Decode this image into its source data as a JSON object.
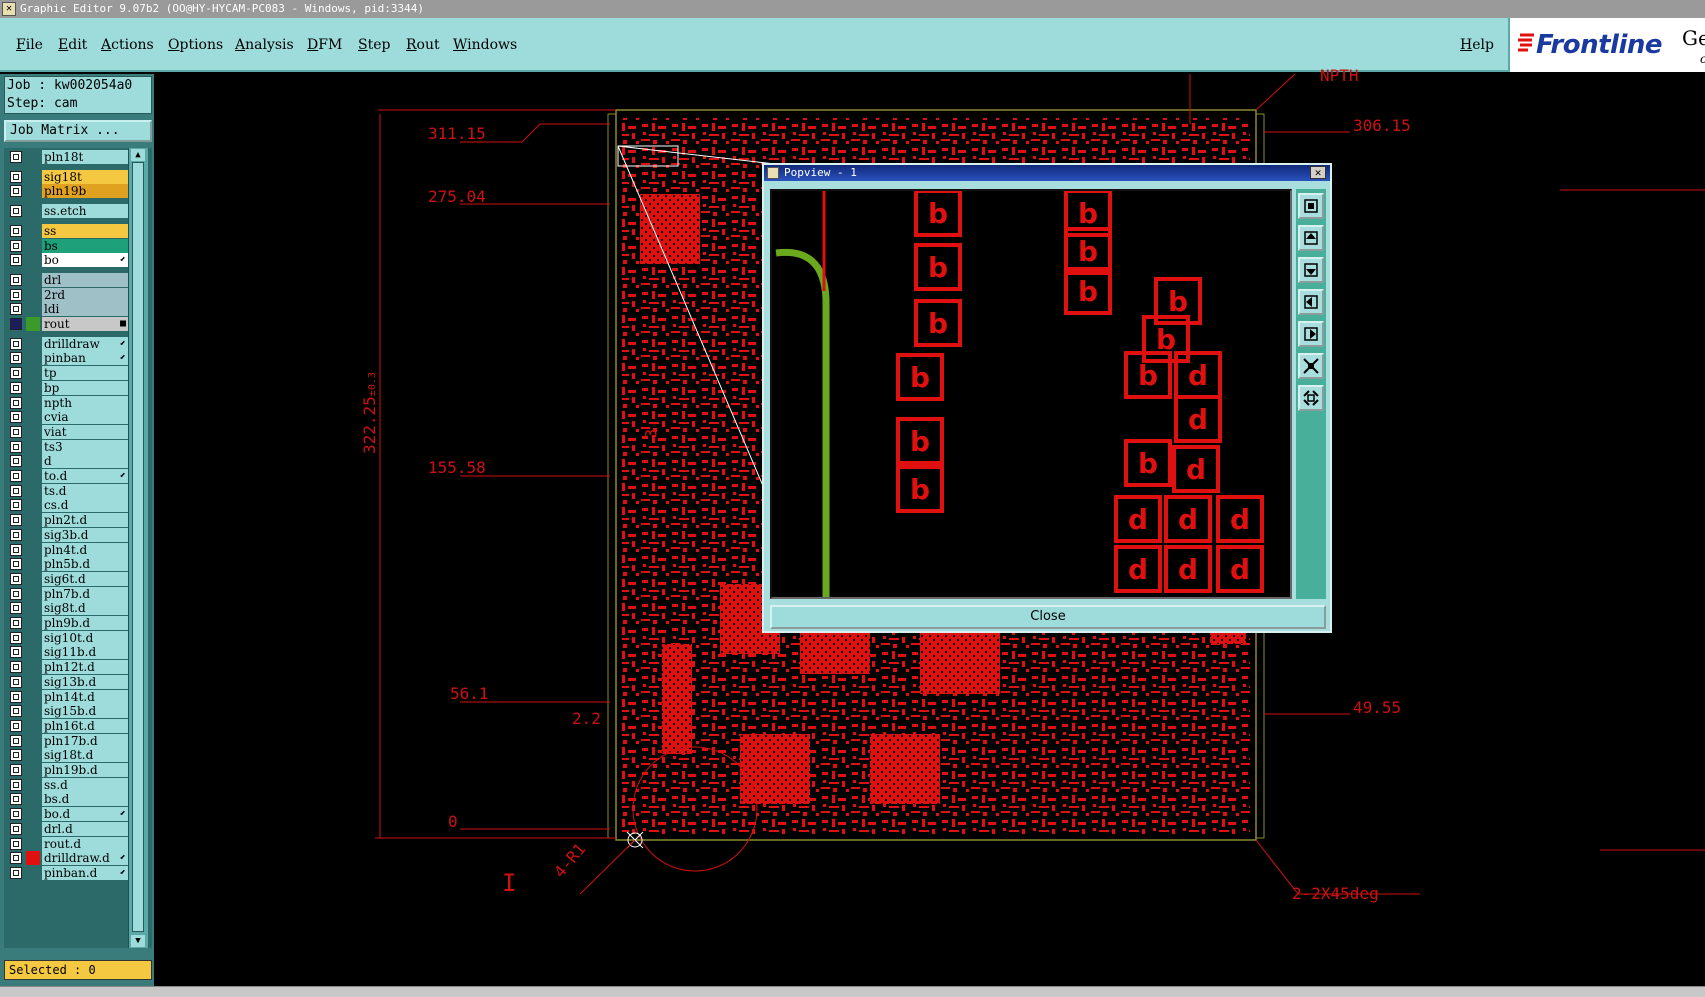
{
  "window": {
    "title": "Graphic Editor 9.07b2 (OO@HY-HYCAM-PC083 - Windows, pid:3344)"
  },
  "menu": {
    "items": [
      "File",
      "Edit",
      "Actions",
      "Options",
      "Analysis",
      "DFM",
      "Step",
      "Rout",
      "Windows"
    ],
    "help": "Help"
  },
  "logo": {
    "brand": "Frontline",
    "ge": "Ge",
    "c": "c",
    "accent": "#1a3aa0"
  },
  "job": {
    "job_line": "Job : kw002054a0",
    "step_line": "Step: cam",
    "matrix_button": "Job Matrix ..."
  },
  "layers": [
    {
      "name": "pln18t",
      "color": "",
      "flag": "",
      "gap_before": false
    },
    {
      "name": "sig18t",
      "color": "#f5c842",
      "flag": "",
      "gap_before": true
    },
    {
      "name": "pln19b",
      "color": "#e0a020",
      "flag": "",
      "gap_before": false
    },
    {
      "name": "ss.etch",
      "color": "",
      "flag": "",
      "gap_before": true
    },
    {
      "name": "ss",
      "color": "#f5c842",
      "flag": "",
      "gap_before": true
    },
    {
      "name": "bs",
      "color": "#1ea07a",
      "flag": "",
      "gap_before": false
    },
    {
      "name": "bo",
      "color": "#ffffff",
      "flag": "⬋",
      "gap_before": false
    },
    {
      "name": "drl",
      "color": "#a0c0c8",
      "flag": "",
      "gap_before": true
    },
    {
      "name": "2rd",
      "color": "#a0c0c8",
      "flag": "",
      "gap_before": false
    },
    {
      "name": "ldi",
      "color": "#a0c0c8",
      "flag": "",
      "gap_before": false
    },
    {
      "name": "rout",
      "color": "#c8c8c8",
      "flag": "■",
      "gap_before": false,
      "active": true,
      "swatch": "#3a9a2a"
    },
    {
      "name": "drilldraw",
      "color": "",
      "flag": "⬋",
      "gap_before": true
    },
    {
      "name": "pinban",
      "color": "",
      "flag": "⬋",
      "gap_before": false
    },
    {
      "name": "tp",
      "color": "",
      "flag": "",
      "gap_before": false
    },
    {
      "name": "bp",
      "color": "",
      "flag": "",
      "gap_before": false
    },
    {
      "name": "npth",
      "color": "",
      "flag": "",
      "gap_before": false
    },
    {
      "name": "cvia",
      "color": "",
      "flag": "",
      "gap_before": false
    },
    {
      "name": "viat",
      "color": "",
      "flag": "",
      "gap_before": false
    },
    {
      "name": "ts3",
      "color": "",
      "flag": "",
      "gap_before": false
    },
    {
      "name": "d",
      "color": "",
      "flag": "",
      "gap_before": false
    },
    {
      "name": "to.d",
      "color": "",
      "flag": "⬋",
      "gap_before": false
    },
    {
      "name": "ts.d",
      "color": "",
      "flag": "",
      "gap_before": false
    },
    {
      "name": "cs.d",
      "color": "",
      "flag": "",
      "gap_before": false
    },
    {
      "name": "pln2t.d",
      "color": "",
      "flag": "",
      "gap_before": false
    },
    {
      "name": "sig3b.d",
      "color": "",
      "flag": "",
      "gap_before": false
    },
    {
      "name": "pln4t.d",
      "color": "",
      "flag": "",
      "gap_before": false
    },
    {
      "name": "pln5b.d",
      "color": "",
      "flag": "",
      "gap_before": false
    },
    {
      "name": "sig6t.d",
      "color": "",
      "flag": "",
      "gap_before": false
    },
    {
      "name": "pln7b.d",
      "color": "",
      "flag": "",
      "gap_before": false
    },
    {
      "name": "sig8t.d",
      "color": "",
      "flag": "",
      "gap_before": false
    },
    {
      "name": "pln9b.d",
      "color": "",
      "flag": "",
      "gap_before": false
    },
    {
      "name": "sig10t.d",
      "color": "",
      "flag": "",
      "gap_before": false
    },
    {
      "name": "sig11b.d",
      "color": "",
      "flag": "",
      "gap_before": false
    },
    {
      "name": "pln12t.d",
      "color": "",
      "flag": "",
      "gap_before": false
    },
    {
      "name": "sig13b.d",
      "color": "",
      "flag": "",
      "gap_before": false
    },
    {
      "name": "pln14t.d",
      "color": "",
      "flag": "",
      "gap_before": false
    },
    {
      "name": "sig15b.d",
      "color": "",
      "flag": "",
      "gap_before": false
    },
    {
      "name": "pln16t.d",
      "color": "",
      "flag": "",
      "gap_before": false
    },
    {
      "name": "pln17b.d",
      "color": "",
      "flag": "",
      "gap_before": false
    },
    {
      "name": "sig18t.d",
      "color": "",
      "flag": "",
      "gap_before": false
    },
    {
      "name": "pln19b.d",
      "color": "",
      "flag": "",
      "gap_before": false
    },
    {
      "name": "ss.d",
      "color": "",
      "flag": "",
      "gap_before": false
    },
    {
      "name": "bs.d",
      "color": "",
      "flag": "",
      "gap_before": false
    },
    {
      "name": "bo.d",
      "color": "",
      "flag": "⬋",
      "gap_before": false
    },
    {
      "name": "drl.d",
      "color": "",
      "flag": "",
      "gap_before": false
    },
    {
      "name": "rout.d",
      "color": "",
      "flag": "",
      "gap_before": false
    },
    {
      "name": "drilldraw.d",
      "color": "",
      "flag": "⬋",
      "gap_before": false,
      "swatch": "#e01010"
    },
    {
      "name": "pinban.d",
      "color": "",
      "flag": "⬋",
      "gap_before": false
    }
  ],
  "selected": "Selected : 0",
  "dimensions": {
    "left": [
      "311.15",
      "275.04",
      "155.58",
      "56.1",
      "2.2",
      "0"
    ],
    "vertical": "322.25",
    "vertical_tol": "±0.3",
    "right_top": "306.15",
    "right_mid": "49.55",
    "top": "NPTH",
    "corner": "2-2X45deg",
    "radius": "4-R1",
    "side": "3",
    "marker": "I"
  },
  "popview": {
    "title": "Popview - 1",
    "close_label": "Close",
    "tools": [
      "zoom-home-icon",
      "pan-up-icon",
      "pan-down-icon",
      "pan-left-icon",
      "pan-right-icon",
      "zoom-in-icon",
      "zoom-out-icon"
    ],
    "pad_labels": {
      "b": "b",
      "d": "d"
    }
  },
  "colors": {
    "copper": "#e01010",
    "rout": "#6aa81e",
    "outline": "#8a8a30",
    "panel": "#9edcdc"
  }
}
